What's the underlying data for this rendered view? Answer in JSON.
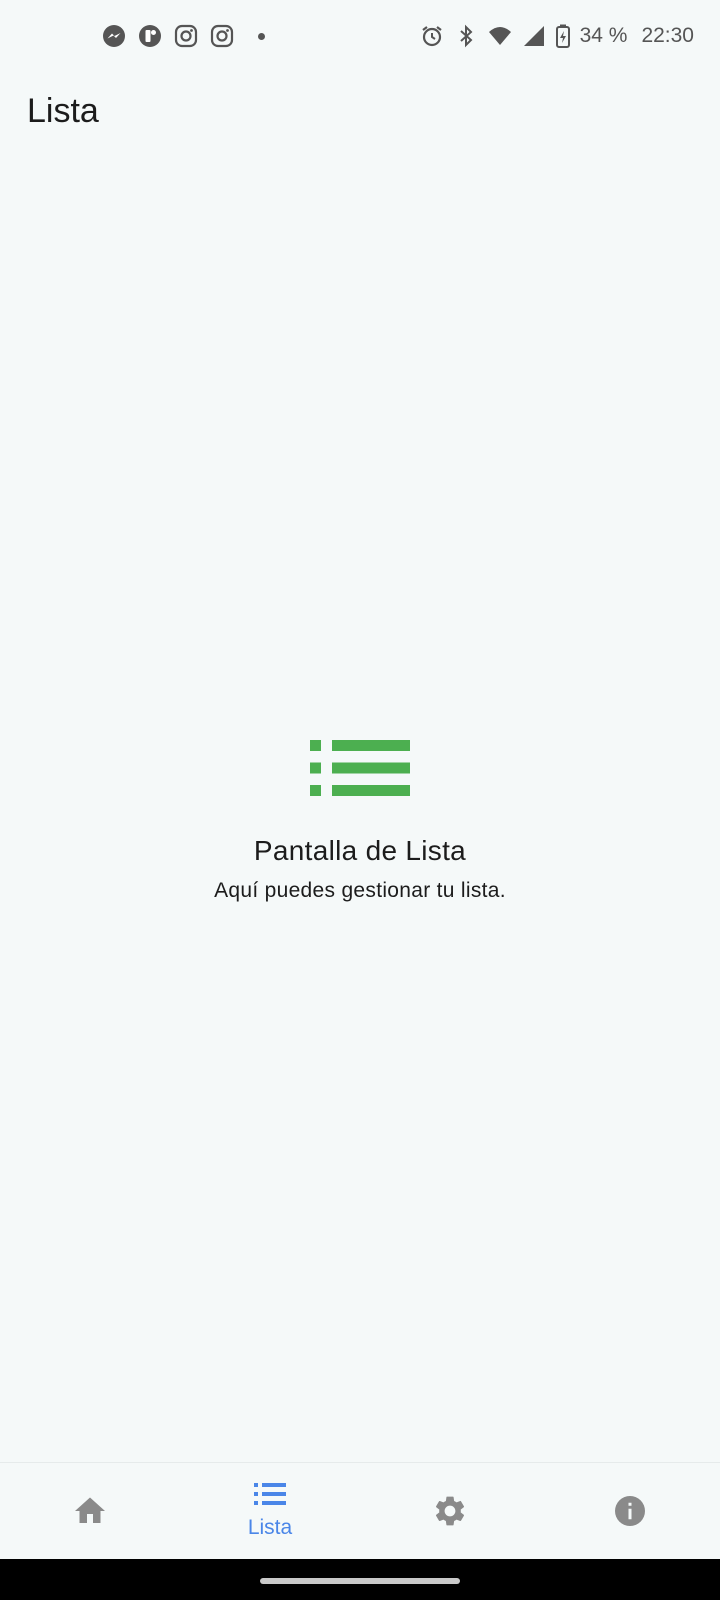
{
  "status_bar": {
    "left_icons": [
      "messenger-icon",
      "notification-app-icon",
      "instagram-icon",
      "instagram-icon"
    ],
    "right_icons": [
      "alarm-icon",
      "bluetooth-icon",
      "wifi-icon",
      "cell-signal-icon",
      "battery-charging-icon"
    ],
    "battery": "34 %",
    "time": "22:30"
  },
  "app_bar": {
    "title": "Lista"
  },
  "content": {
    "icon": "list-icon",
    "icon_color": "#4caf50",
    "heading": "Pantalla de Lista",
    "subtitle": "Aquí puedes gestionar tu lista."
  },
  "bottom_nav": {
    "items": [
      {
        "icon": "home-icon",
        "label": ""
      },
      {
        "icon": "list-icon",
        "label": "Lista"
      },
      {
        "icon": "gear-icon",
        "label": ""
      },
      {
        "icon": "info-icon",
        "label": ""
      }
    ],
    "selected_index": 1,
    "active_color": "#4a86e8",
    "inactive_color": "#8a8a8a"
  }
}
